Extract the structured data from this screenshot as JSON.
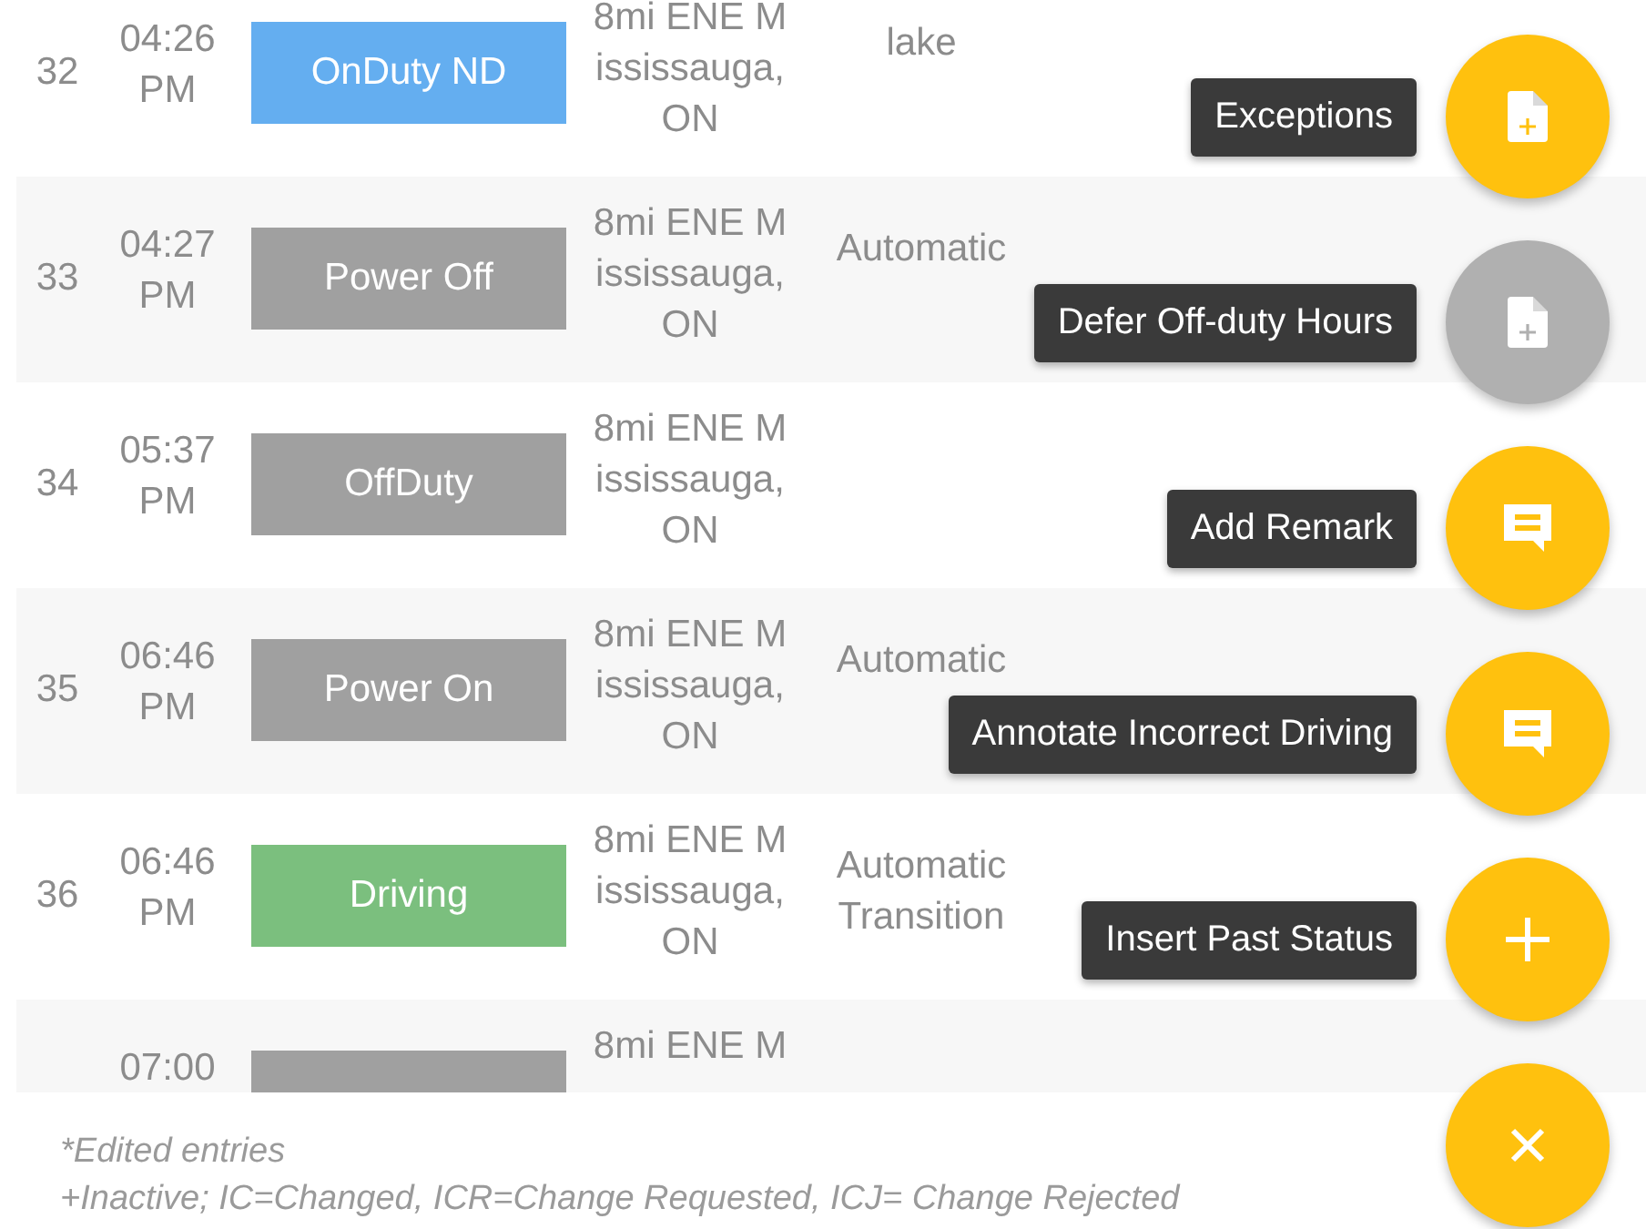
{
  "log_rows": [
    {
      "number": "32",
      "time": [
        "04:26",
        "PM"
      ],
      "status": {
        "label": "OnDuty ND",
        "kind": "on_duty"
      },
      "location": [
        "8mi ENE M",
        "ississauga,",
        "ON"
      ],
      "remark": [
        "lake"
      ]
    },
    {
      "number": "33",
      "time": [
        "04:27",
        "PM"
      ],
      "status": {
        "label": "Power Off",
        "kind": "power"
      },
      "location": [
        "8mi ENE M",
        "ississauga,",
        "ON"
      ],
      "remark": [
        "Automatic"
      ]
    },
    {
      "number": "34",
      "time": [
        "05:37",
        "PM"
      ],
      "status": {
        "label": "OffDuty",
        "kind": "off_duty"
      },
      "location": [
        "8mi ENE M",
        "ississauga,",
        "ON"
      ]
    },
    {
      "number": "35",
      "time": [
        "06:46",
        "PM"
      ],
      "status": {
        "label": "Power On",
        "kind": "power"
      },
      "location": [
        "8mi ENE M",
        "ississauga,",
        "ON"
      ],
      "remark": [
        "Automatic"
      ]
    },
    {
      "number": "36",
      "time": [
        "06:46",
        "PM"
      ],
      "status": {
        "label": "Driving",
        "kind": "driving"
      },
      "location": [
        "8mi ENE M",
        "ississauga,",
        "ON"
      ],
      "remark": [
        "Automatic",
        "Transition"
      ]
    },
    {
      "time": [
        "07:00"
      ],
      "status": {
        "kind": "off_duty"
      },
      "location": [
        "8mi ENE M"
      ]
    }
  ],
  "footer_notes": [
    "*Edited entries",
    "+Inactive; IC=Changed, ICR=Change Requested, ICJ= Change Rejected"
  ],
  "fab_menu": [
    {
      "label": "Exceptions",
      "kind": "document",
      "disabled": false
    },
    {
      "label": "Defer Off-duty Hours",
      "kind": "document",
      "disabled": true
    },
    {
      "label": "Add Remark",
      "kind": "comment",
      "disabled": false
    },
    {
      "label": "Annotate Incorrect Driving",
      "kind": "comment",
      "disabled": false
    },
    {
      "label": "Insert Past Status",
      "kind": "plus",
      "disabled": false
    }
  ]
}
